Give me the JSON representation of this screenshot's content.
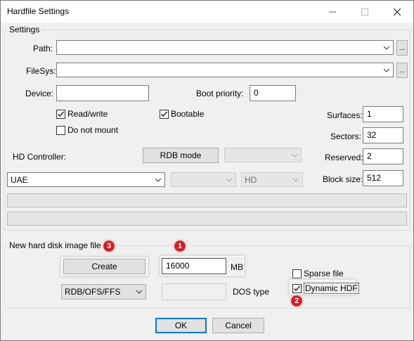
{
  "window": {
    "title": "Hardfile Settings"
  },
  "settings": {
    "group_title": "Settings",
    "path_label": "Path:",
    "path_value": "",
    "filesys_label": "FileSys:",
    "filesys_value": "",
    "browse_label": "...",
    "device_label": "Device:",
    "device_value": "",
    "boot_priority_label": "Boot priority:",
    "boot_priority_value": "0",
    "read_write_label": "Read/write",
    "read_write_checked": true,
    "bootable_label": "Bootable",
    "bootable_checked": true,
    "do_not_mount_label": "Do not mount",
    "do_not_mount_checked": false,
    "surfaces_label": "Surfaces:",
    "surfaces_value": "1",
    "sectors_label": "Sectors:",
    "sectors_value": "32",
    "reserved_label": "Reserved:",
    "reserved_value": "2",
    "block_size_label": "Block size:",
    "block_size_value": "512",
    "hd_controller_label": "HD Controller:",
    "rdb_mode_label": "RDB mode",
    "controller_value": "UAE",
    "hd_value": "HD"
  },
  "new_image": {
    "group_title": "New hard disk image file",
    "create_label": "Create",
    "size_value": "16000",
    "size_unit": "MB",
    "sparse_label": "Sparse file",
    "sparse_checked": false,
    "dynamic_label": "Dynamic HDF",
    "dynamic_checked": true,
    "fs_type_value": "RDB/OFS/FFS",
    "dos_type_value": "",
    "dos_type_label": "DOS type"
  },
  "footer": {
    "ok_label": "OK",
    "cancel_label": "Cancel"
  },
  "markers": {
    "one": "1",
    "two": "2",
    "three": "3"
  },
  "colors": {
    "accent": "#0078d7",
    "marker": "#d21f26"
  }
}
